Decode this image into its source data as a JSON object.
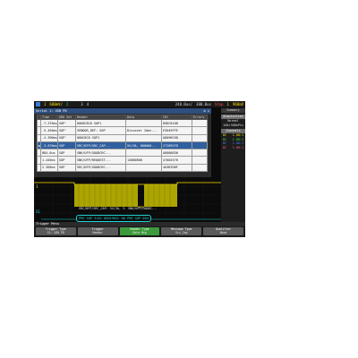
{
  "topbar": {
    "ch1_num": "1",
    "ch1_scale": "680mV/",
    "ch2_num": "2",
    "ch3_num": "3",
    "ch4_num": "4",
    "time_offset": "240.0us/",
    "time_scale": "300.0us",
    "run_state": "Stop",
    "trig_num": "1",
    "trig_level": "968mV"
  },
  "decode": {
    "title": "Serial 1: USB PD",
    "columns": [
      "",
      "Time",
      "ORD Set",
      "Header",
      "Data",
      "CRC",
      "Errors"
    ],
    "rows": [
      [
        "",
        "-7.376ms",
        "SOP'",
        "0000C8C0 SOP1",
        "",
        "D9DC810D",
        ""
      ],
      [
        "",
        "-5.456ms",
        "SOP'",
        "VENDOR_DEF: SOP",
        "Discover Iden...",
        "E3049FFE",
        ""
      ],
      [
        "",
        "-4.390ms",
        "SOP'",
        "000C8C0 SOP1",
        "",
        "A8096C68",
        ""
      ],
      [
        "",
        "-3.670ms",
        "SOP",
        "SRC/DFP/SRC_CAP...",
        "5V/3A, 000000...",
        "272892FD",
        ""
      ],
      [
        "",
        "884.0us",
        "SOP",
        "SNK/UFP/GOODCRC...",
        "",
        "A8080ED0",
        ""
      ],
      [
        "",
        "1.445ms",
        "SOP",
        "SNK/UFP/REQUEST...",
        "13080808",
        "47602570",
        ""
      ],
      [
        "",
        "2.305ms",
        "SOP",
        "SRC/DFP/GOODCRC...",
        "",
        "4A3B7D8F",
        ""
      ]
    ]
  },
  "sidebar": {
    "header": "Summary",
    "acquisition_label": "Acquisition",
    "mode": "Normal",
    "sample_rate": "1GHz",
    "points": "500kPts",
    "channels_label": "Channels",
    "channels": [
      {
        "name": "DC",
        "value": "1.00:1"
      },
      {
        "name": "DC",
        "value": "1.00:1"
      },
      {
        "name": "DC",
        "value": "1.00:1"
      },
      {
        "name": "DC",
        "value": "1.00:1"
      }
    ]
  },
  "wave": {
    "decode_line1": "SRC/DFP/SRC_CAP: 5V/3A, 3.  SNK/UFP/GOODC...",
    "decode_line2": "PRE SOP 3161 0001982C 00     PRE SOP 004"
  },
  "menu": {
    "title": "Trigger Menu",
    "keys": [
      {
        "label": "Trigger Type",
        "value": "S1: USB PD"
      },
      {
        "label": "Trigger",
        "value": "Header"
      },
      {
        "label": "Header Type",
        "value": "Data Msg"
      },
      {
        "label": "Message Type",
        "value": "Src_Cap"
      },
      {
        "label": "Qualifier",
        "value": "None"
      }
    ]
  },
  "colors": {
    "ch1": "#ffe000",
    "ch2": "#3fe03f",
    "decode_bus": "#1fd3d3",
    "selected_row": "#2f5f9f",
    "active_key": "#3c9a3c"
  }
}
